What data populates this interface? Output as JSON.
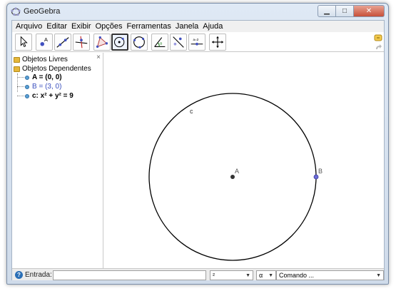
{
  "window": {
    "title": "GeoGebra",
    "controls": {
      "minimize": "▁",
      "maximize": "□",
      "close": "✕"
    }
  },
  "menu": [
    "Arquivo",
    "Editar",
    "Exibir",
    "Opções",
    "Ferramentas",
    "Janela",
    "Ajuda"
  ],
  "toolbar": {
    "tools": [
      "move-tool",
      "new-point-tool",
      "line-tool",
      "perpendicular-line-tool",
      "polygon-tool",
      "circle-center-point-tool",
      "circle-three-points-tool",
      "angle-tool",
      "reflect-tool",
      "slider-tool",
      "move-graphics-view-tool"
    ],
    "selected_tool": "circle-center-point-tool",
    "slider_tool_text": "a = 2"
  },
  "algebra": {
    "close": "×",
    "free_objects_label": "Objetos Livres",
    "dependent_objects_label": "Objetos Dependentes",
    "objects": [
      {
        "text": "A = (0, 0)",
        "style": "bold",
        "color": "#000000"
      },
      {
        "text": "B = (3, 0)",
        "style": "normal",
        "color": "#3a4fbf"
      },
      {
        "text": "c: x² + y² = 9",
        "style": "bold",
        "color": "#000000"
      }
    ]
  },
  "graphics": {
    "circle_label": "c",
    "point_a_label": "A",
    "point_b_label": "B",
    "point_a_color": "#333333",
    "point_b_color": "#6b6bd6"
  },
  "inputbar": {
    "help_icon": "?",
    "label": "Entrada:",
    "value": "",
    "power_combo": "²",
    "alpha_combo": "α",
    "command_combo": "Comando ..."
  }
}
